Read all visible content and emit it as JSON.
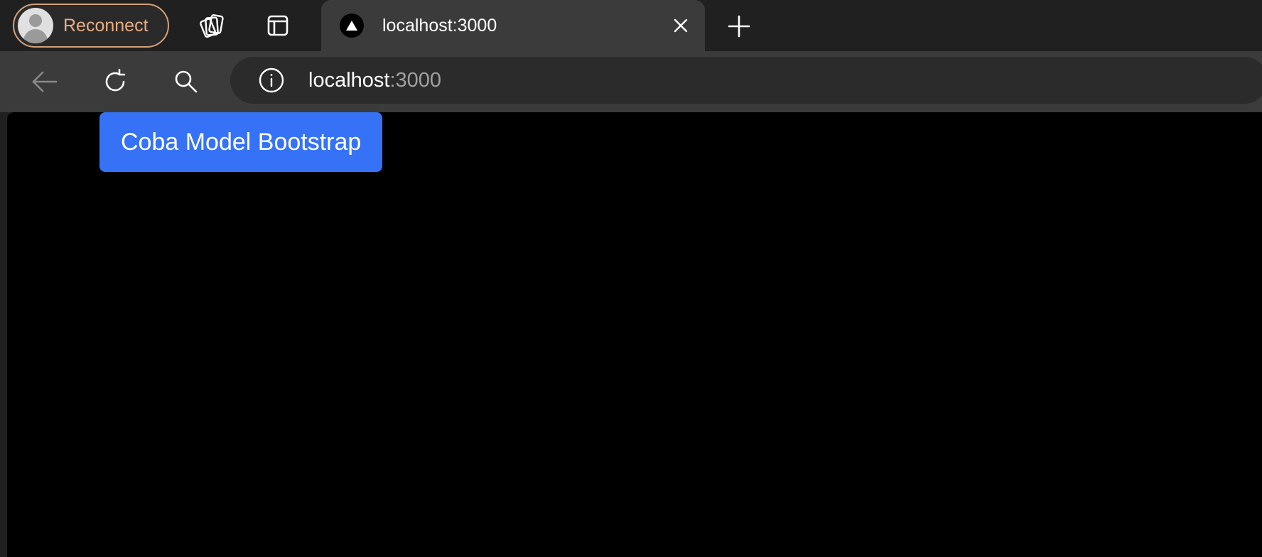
{
  "profile": {
    "label": "Reconnect",
    "accent": "#e8ae82"
  },
  "tab_actions": {
    "icons": [
      "collections-icon",
      "vertical-tabs-icon"
    ]
  },
  "tab": {
    "title": "localhost:3000",
    "favicon": "triangle-logo-icon"
  },
  "toolbar": {
    "icons": [
      "back-arrow-icon",
      "refresh-icon",
      "search-icon"
    ]
  },
  "address": {
    "host": "localhost",
    "port": ":3000"
  },
  "page": {
    "button_label": "Coba Model Bootstrap",
    "button_color": "#3572f6"
  }
}
